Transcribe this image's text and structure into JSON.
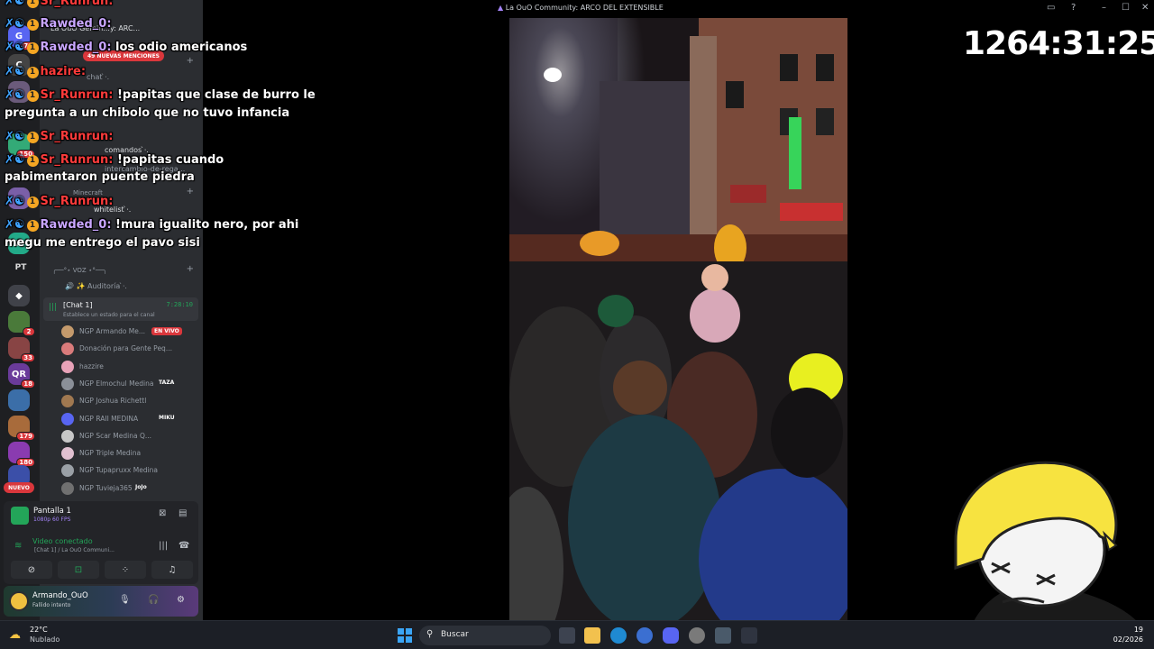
{
  "window": {
    "title": "La OuO Community: ARCO DEL EXTENSIBLE",
    "timer": "1264:31:25"
  },
  "discord": {
    "server_header": "La OuO Gemin...y: ARC...",
    "mentions_pill": "49 NUEVAS MENCIONES",
    "nuevo_pill": "NUEVO",
    "guild_label": "PT",
    "guild_badges": [
      "70",
      "2",
      "33",
      "18",
      "179",
      "180",
      "150"
    ],
    "channels": [
      {
        "label": "chat ̀⋅."
      },
      {
        "label": "comandos ̀⋅."
      },
      {
        "label": "intercambio-de-rega..."
      },
      {
        "label": "whitelist ̀⋅."
      }
    ],
    "categories": [
      {
        "label": "Minecraft"
      },
      {
        "label": "╭──°⋆ VOZ ⋆°──╮"
      }
    ],
    "auditoria": "Auditoría ̀⋅.",
    "voice_channel": {
      "name": "[Chat 1]",
      "time": "7:28:10",
      "status": "Establece un estado para el canal"
    },
    "members": [
      {
        "name": "NGP Armando Me...",
        "tag": "EN VIVO",
        "color": "#c49a6c"
      },
      {
        "name": "Donación para Gente Peq...",
        "tag": "",
        "color": "#d97b7b"
      },
      {
        "name": "hazzire",
        "tag": "",
        "color": "#e8a2b8"
      },
      {
        "name": "NGP Elmochul Medina",
        "tag": "TAZA",
        "color": "#8a8f98"
      },
      {
        "name": "NGP Joshua Richettl",
        "tag": "",
        "color": "#a07850"
      },
      {
        "name": "NGP RAII MEDINA",
        "tag": "MIKU",
        "color": "#5865f2"
      },
      {
        "name": "NGP Scar Medina Q...",
        "tag": "",
        "color": "#c7c7c7"
      },
      {
        "name": "NGP Triple Medina",
        "tag": "",
        "color": "#e0c0d0"
      },
      {
        "name": "NGP Tupapruxx Medina",
        "tag": "",
        "color": "#9aa0a6"
      },
      {
        "name": "NGP Tuvieja365",
        "tag": "JoJo",
        "color": "#707070"
      }
    ],
    "screen_share": {
      "title": "Pantalla 1",
      "quality": "1080p 60 FPS"
    },
    "video_connected": {
      "label": "Video conectado",
      "detail": "[Chat 1] / La OuO Communi..."
    },
    "user": {
      "name": "Armando_OuO",
      "status": "Fallido intento"
    }
  },
  "chat": {
    "messages": [
      {
        "user": "Rawded_0:",
        "text": " los odio americanos",
        "user_class": "purple"
      },
      {
        "user": "hazire:",
        "text": "",
        "user_class": "red"
      },
      {
        "user": "Sr_Runrun:",
        "text": " !papitas que clase de burro le",
        "user_class": "red"
      },
      {
        "user": "Sr_Runrun:",
        "text": "",
        "user_class": "red"
      },
      {
        "user": "Sr_Runrun:",
        "text": " !papitas cuando",
        "user_class": "red"
      },
      {
        "user": "Sr_Runrun:",
        "text": "",
        "user_class": "red"
      },
      {
        "user": "Rawded_0:",
        "text": " !mura igualito nero, por ahi",
        "user_class": "purple"
      }
    ],
    "continuations": [
      "pregunta a un chibolo que no tuvo infancia",
      "pabimentaron puente piedra",
      "megu me entrego el pavo sisi"
    ],
    "top_user_1": "Sr_Runrun:",
    "top_user_2": "Rawded_0:"
  },
  "taskbar": {
    "temp": "22°C",
    "weather": "Nublado",
    "search": "Buscar",
    "clock_time": "19",
    "clock_date": "02/2026"
  }
}
